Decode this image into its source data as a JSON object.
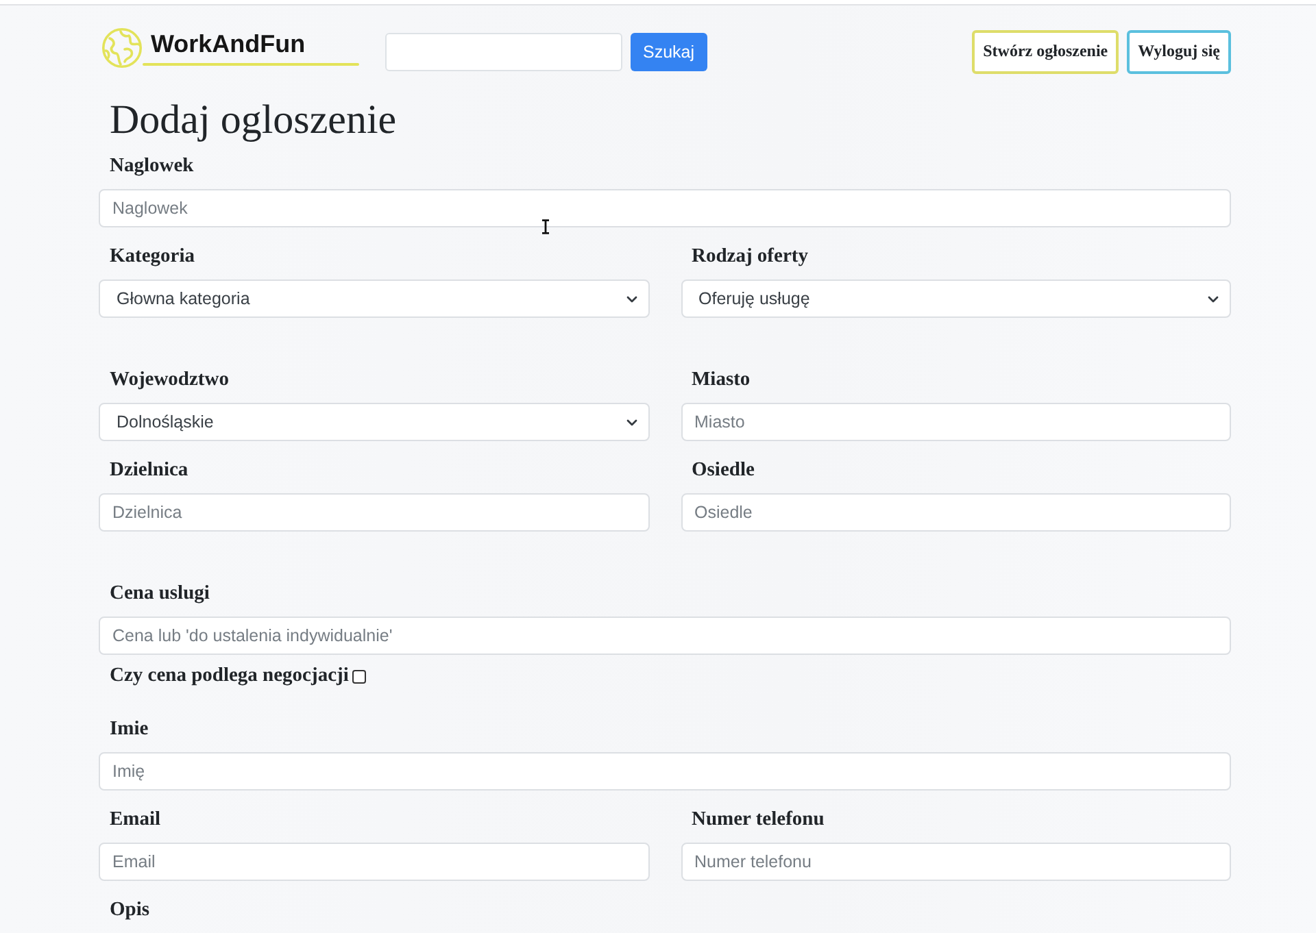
{
  "header": {
    "logo": "WorkAndFun",
    "search_button": "Szukaj",
    "buttons": [
      {
        "label": "Stwórz ogłoszenie",
        "color": "#dedd6a"
      },
      {
        "label": "Wyloguj się",
        "color": "#5bc0de"
      }
    ]
  },
  "form": {
    "title": "Dodaj ogloszenie",
    "sections": [
      {
        "rows": [
          {
            "fields": [
              {
                "label": "Naglowek",
                "kind": "input",
                "placeholder": "Naglowek"
              }
            ]
          },
          {
            "fields": [
              {
                "label": "Kategoria",
                "kind": "select",
                "value": "Głowna kategoria"
              },
              {
                "label": "Rodzaj oferty",
                "kind": "select",
                "value": "Oferuję usługę"
              }
            ]
          }
        ]
      },
      {
        "rows": [
          {
            "fields": [
              {
                "label": "Wojewodztwo",
                "kind": "select",
                "value": "Dolnośląskie"
              },
              {
                "label": "Miasto",
                "kind": "input",
                "placeholder": "Miasto"
              }
            ]
          },
          {
            "fields": [
              {
                "label": "Dzielnica",
                "kind": "input",
                "placeholder": "Dzielnica"
              },
              {
                "label": "Osiedle",
                "kind": "input",
                "placeholder": "Osiedle"
              }
            ]
          }
        ]
      },
      {
        "rows": [
          {
            "fields": [
              {
                "label": "Cena uslugi",
                "kind": "input",
                "placeholder": "Cena lub 'do ustalenia indywidualnie'",
                "checkbox": {
                  "label": "Czy cena podlega negocjacji",
                  "checked": false
                }
              }
            ]
          },
          {
            "fields": [
              {
                "label": "Imie",
                "kind": "input",
                "placeholder": "Imię"
              }
            ]
          },
          {
            "fields": [
              {
                "label": "Email",
                "kind": "input",
                "placeholder": "Email"
              },
              {
                "label": "Numer telefonu",
                "kind": "input",
                "placeholder": "Numer telefonu"
              }
            ]
          },
          {
            "fields": [
              {
                "label": "Opis",
                "kind": "heading"
              }
            ]
          }
        ]
      }
    ]
  }
}
